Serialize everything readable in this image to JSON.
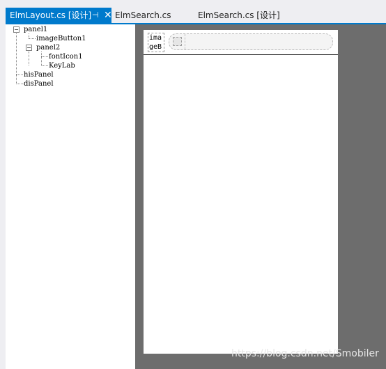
{
  "tabs": [
    {
      "label": "ElmLayout.cs [设计]",
      "active": true
    },
    {
      "label": "ElmSearch.cs",
      "active": false
    },
    {
      "label": "ElmSearch.cs [设计]",
      "active": false
    }
  ],
  "icons": {
    "pin": "pin-icon",
    "close": "close-icon",
    "expand": "minus-box-icon",
    "search": "search-icon"
  },
  "outline": {
    "panel1": "panel1",
    "imageButton1": "imageButton1",
    "panel2": "panel2",
    "fontIcon1": "fontIcon1",
    "keyLab": "KeyLab",
    "hisPanel": "hisPanel",
    "disPanel": "disPanel"
  },
  "designer": {
    "image_button_text_line1": "ima",
    "image_button_text_line2": "geB"
  },
  "watermark": "https://blog.csdn.net/Smobiler",
  "colors": {
    "tab_active_bg": "#007acc",
    "design_background": "#6d6d6d",
    "canvas": "#ffffff"
  }
}
